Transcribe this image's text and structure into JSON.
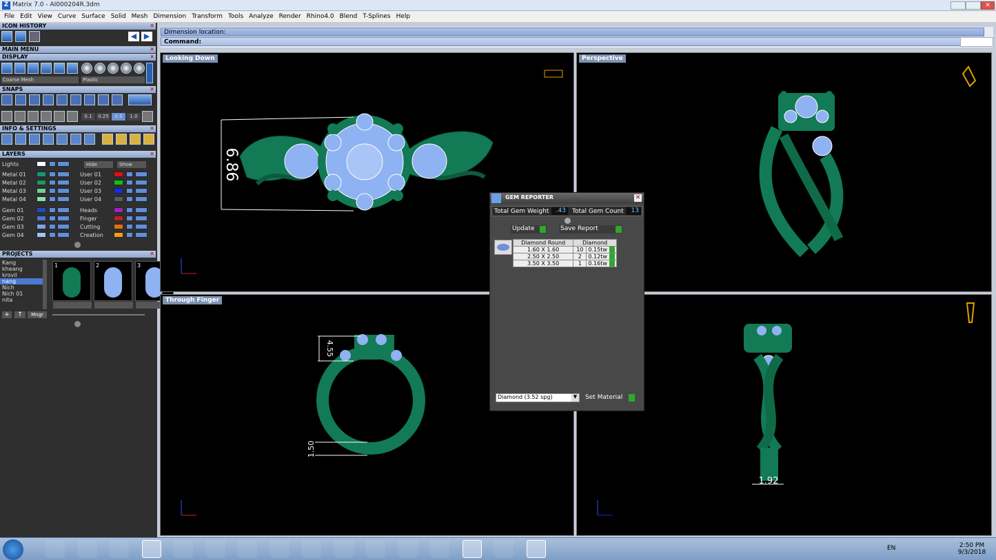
{
  "app": {
    "title": "Matrix 7.0 - AI000204R.3dm"
  },
  "menu": [
    "File",
    "Edit",
    "View",
    "Curve",
    "Surface",
    "Solid",
    "Mesh",
    "Dimension",
    "Transform",
    "Tools",
    "Analyze",
    "Render",
    "Rhino4.0",
    "Blend",
    "T-Splines",
    "Help"
  ],
  "panels": {
    "icon_history": "ICON HISTORY",
    "main_menu": "MAIN MENU",
    "display": "DISPLAY",
    "snaps": "SNAPS",
    "info_settings": "INFO & SETTINGS",
    "layers": "LAYERS",
    "projects": "PROJECTS"
  },
  "display": {
    "mesh": "Coarse Mesh",
    "material": "Plastic"
  },
  "snaps": {
    "values": [
      "0.1",
      "0.25",
      "0.5",
      "1.0"
    ]
  },
  "layers": {
    "lights": "Lights",
    "hide": "Hide",
    "show": "Show",
    "left": [
      "Metal 01",
      "Metal 02",
      "Metal 03",
      "Metal 04",
      "Gem 01",
      "Gem 02",
      "Gem 03",
      "Gem 04"
    ],
    "right": [
      "User 01",
      "User 02",
      "User 03",
      "User 04",
      "Heads",
      "Finger",
      "Cutting",
      "Creation"
    ],
    "left_colors": [
      "#0f9a6a",
      "#1a9a5a",
      "#6fd08a",
      "#8ce0a0",
      "#1d4fb8",
      "#4a7ad0",
      "#7fa3e0",
      "#a5c2ee"
    ],
    "right_colors": [
      "#e01010",
      "#10c010",
      "#1030e0",
      "#5a5a5a",
      "#a020c0",
      "#c02020",
      "#e07010",
      "#f0a010"
    ]
  },
  "projects": {
    "names": [
      "Kang",
      "kheang",
      "krovil",
      "nang",
      "Nich",
      "Nich 01",
      "nita"
    ],
    "selected": "nang",
    "thumbs": [
      "1",
      "2",
      "3"
    ],
    "mngr": "Mngr"
  },
  "command": {
    "prompt": "Dimension location:",
    "label": "Command:"
  },
  "viewports": {
    "top_left": "Looking Down",
    "top_right": "Perspective",
    "bottom_left": "Through Finger"
  },
  "dimensions": {
    "width": "6.86",
    "height": "4.55",
    "shank": "1.50",
    "side": "1.92"
  },
  "gem": {
    "title": "GEM REPORTER",
    "weight_label": "Total Gem Weight",
    "weight": ".43",
    "count_label": "Total Gem Count",
    "count": "13",
    "update": "Update",
    "save": "Save Report",
    "headers": [
      "Diamond Round",
      "Diamond"
    ],
    "rows": [
      {
        "size": "1.60 X 1.60",
        "qty": "10",
        "tw": "0.15tw"
      },
      {
        "size": "2.50 X 2.50",
        "qty": "2",
        "tw": "0.12tw"
      },
      {
        "size": "3.50 X 3.50",
        "qty": "1",
        "tw": "0.16tw"
      }
    ],
    "material": "Diamond    (3.52 spg)",
    "set_material": "Set Material"
  },
  "tray": {
    "lang": "EN",
    "time": "2:50 PM",
    "date": "9/3/2018"
  },
  "colors": {
    "metal": "#127a55",
    "gem": "#8fb2f2",
    "accent": "#3d7bd6"
  }
}
